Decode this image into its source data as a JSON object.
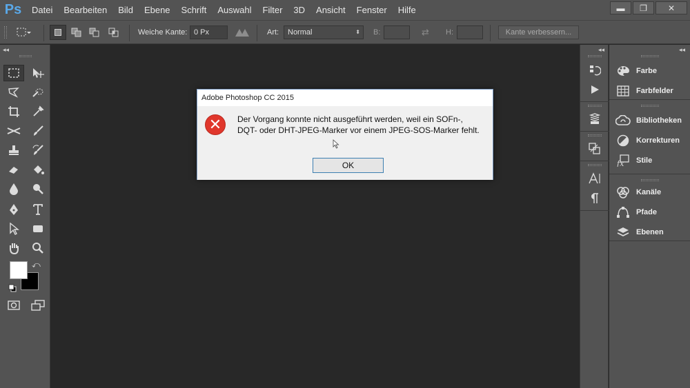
{
  "app": {
    "logo": "Ps"
  },
  "menu": [
    "Datei",
    "Bearbeiten",
    "Bild",
    "Ebene",
    "Schrift",
    "Auswahl",
    "Filter",
    "3D",
    "Ansicht",
    "Fenster",
    "Hilfe"
  ],
  "window_controls": {
    "minimize": "▬",
    "restore": "❐",
    "close": "✕"
  },
  "options": {
    "feather_label": "Weiche Kante:",
    "feather_value": "0 Px",
    "style_label": "Art:",
    "style_value": "Normal",
    "width_label": "B:",
    "height_label": "H:",
    "refine_edge": "Kante verbessern..."
  },
  "collapse_arrows": "◂◂",
  "panels": [
    {
      "icon": "color-palette-icon",
      "label": "Farbe"
    },
    {
      "icon": "swatches-grid-icon",
      "label": "Farbfelder"
    },
    {
      "icon": "libraries-icon",
      "label": "Bibliotheken"
    },
    {
      "icon": "adjustments-icon",
      "label": "Korrekturen"
    },
    {
      "icon": "styles-fx-icon",
      "label": "Stile"
    },
    {
      "icon": "channels-icon",
      "label": "Kanäle"
    },
    {
      "icon": "paths-icon",
      "label": "Pfade"
    },
    {
      "icon": "layers-icon",
      "label": "Ebenen"
    }
  ],
  "dialog": {
    "title": "Adobe Photoshop CC 2015",
    "message_line1": "Der Vorgang konnte nicht ausgeführt werden, weil ein SOFn-,",
    "message_line2": "DQT- oder DHT-JPEG-Marker vor einem JPEG-SOS-Marker fehlt.",
    "ok_label": "OK",
    "error_symbol": "✕"
  },
  "colors": {
    "ui_gray": "#535353",
    "canvas": "#282828",
    "ps_blue": "#5aa8e8",
    "error_red": "#e0372c",
    "button_focus": "#3c7fb1"
  }
}
